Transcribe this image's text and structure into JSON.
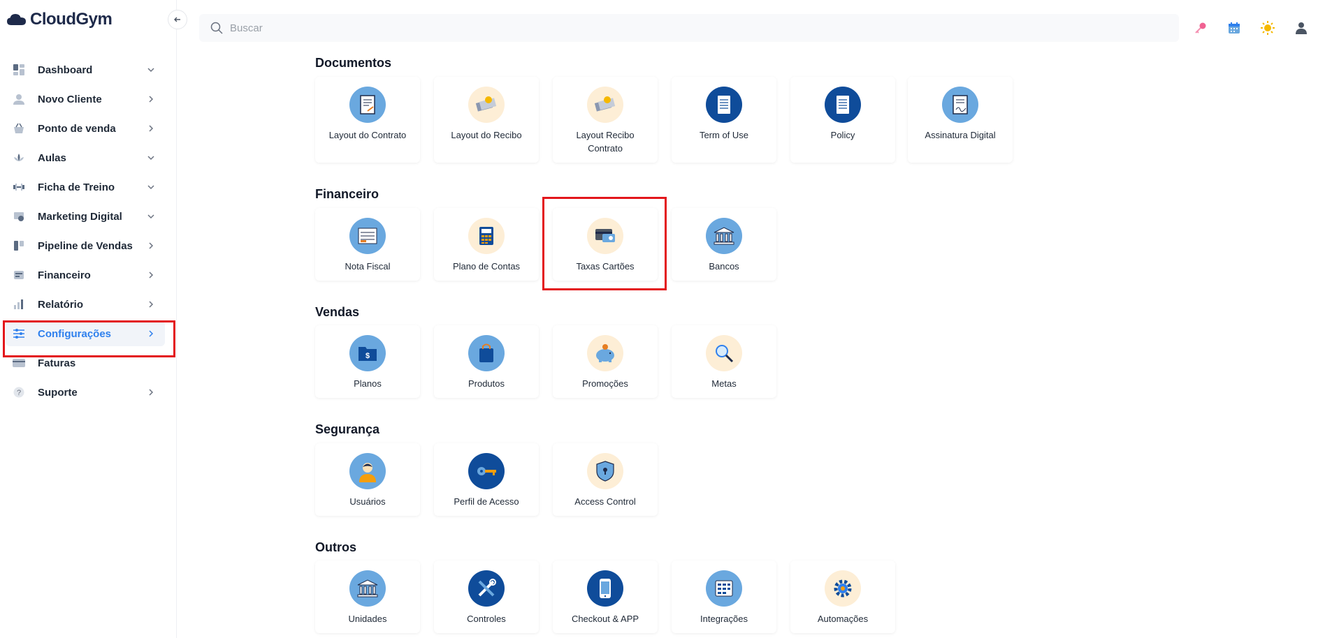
{
  "app": {
    "logo_text": "CloudGym"
  },
  "search": {
    "placeholder": "Buscar"
  },
  "sidebar": {
    "items": [
      {
        "label": "Dashboard"
      },
      {
        "label": "Novo Cliente"
      },
      {
        "label": "Ponto de venda"
      },
      {
        "label": "Aulas"
      },
      {
        "label": "Ficha de Treino"
      },
      {
        "label": "Marketing Digital"
      },
      {
        "label": "Pipeline de Vendas"
      },
      {
        "label": "Financeiro"
      },
      {
        "label": "Relatório"
      },
      {
        "label": "Configurações"
      },
      {
        "label": "Faturas"
      },
      {
        "label": "Suporte"
      }
    ]
  },
  "sections": {
    "documentos": {
      "title": "Documentos",
      "cards": [
        {
          "label": "Layout do Contrato"
        },
        {
          "label": "Layout do Recibo"
        },
        {
          "label": "Layout Recibo Contrato"
        },
        {
          "label": "Term of Use"
        },
        {
          "label": "Policy"
        },
        {
          "label": "Assinatura Digital"
        }
      ]
    },
    "financeiro": {
      "title": "Financeiro",
      "cards": [
        {
          "label": "Nota Fiscal"
        },
        {
          "label": "Plano de Contas"
        },
        {
          "label": "Taxas Cartões"
        },
        {
          "label": "Bancos"
        }
      ]
    },
    "vendas": {
      "title": "Vendas",
      "cards": [
        {
          "label": "Planos"
        },
        {
          "label": "Produtos"
        },
        {
          "label": "Promoções"
        },
        {
          "label": "Metas"
        }
      ]
    },
    "seguranca": {
      "title": "Segurança",
      "cards": [
        {
          "label": "Usuários"
        },
        {
          "label": "Perfil de Acesso"
        },
        {
          "label": "Access Control"
        }
      ]
    },
    "outros": {
      "title": "Outros",
      "cards": [
        {
          "label": "Unidades"
        },
        {
          "label": "Controles"
        },
        {
          "label": "Checkout & APP"
        },
        {
          "label": "Integrações"
        },
        {
          "label": "Automações"
        }
      ]
    }
  },
  "colors": {
    "accent": "#2f80ed",
    "highlight": "#e3161b",
    "icon_blue": "#6aa8df",
    "icon_dark": "#0f4c9a",
    "icon_cream": "#fdeed6"
  }
}
